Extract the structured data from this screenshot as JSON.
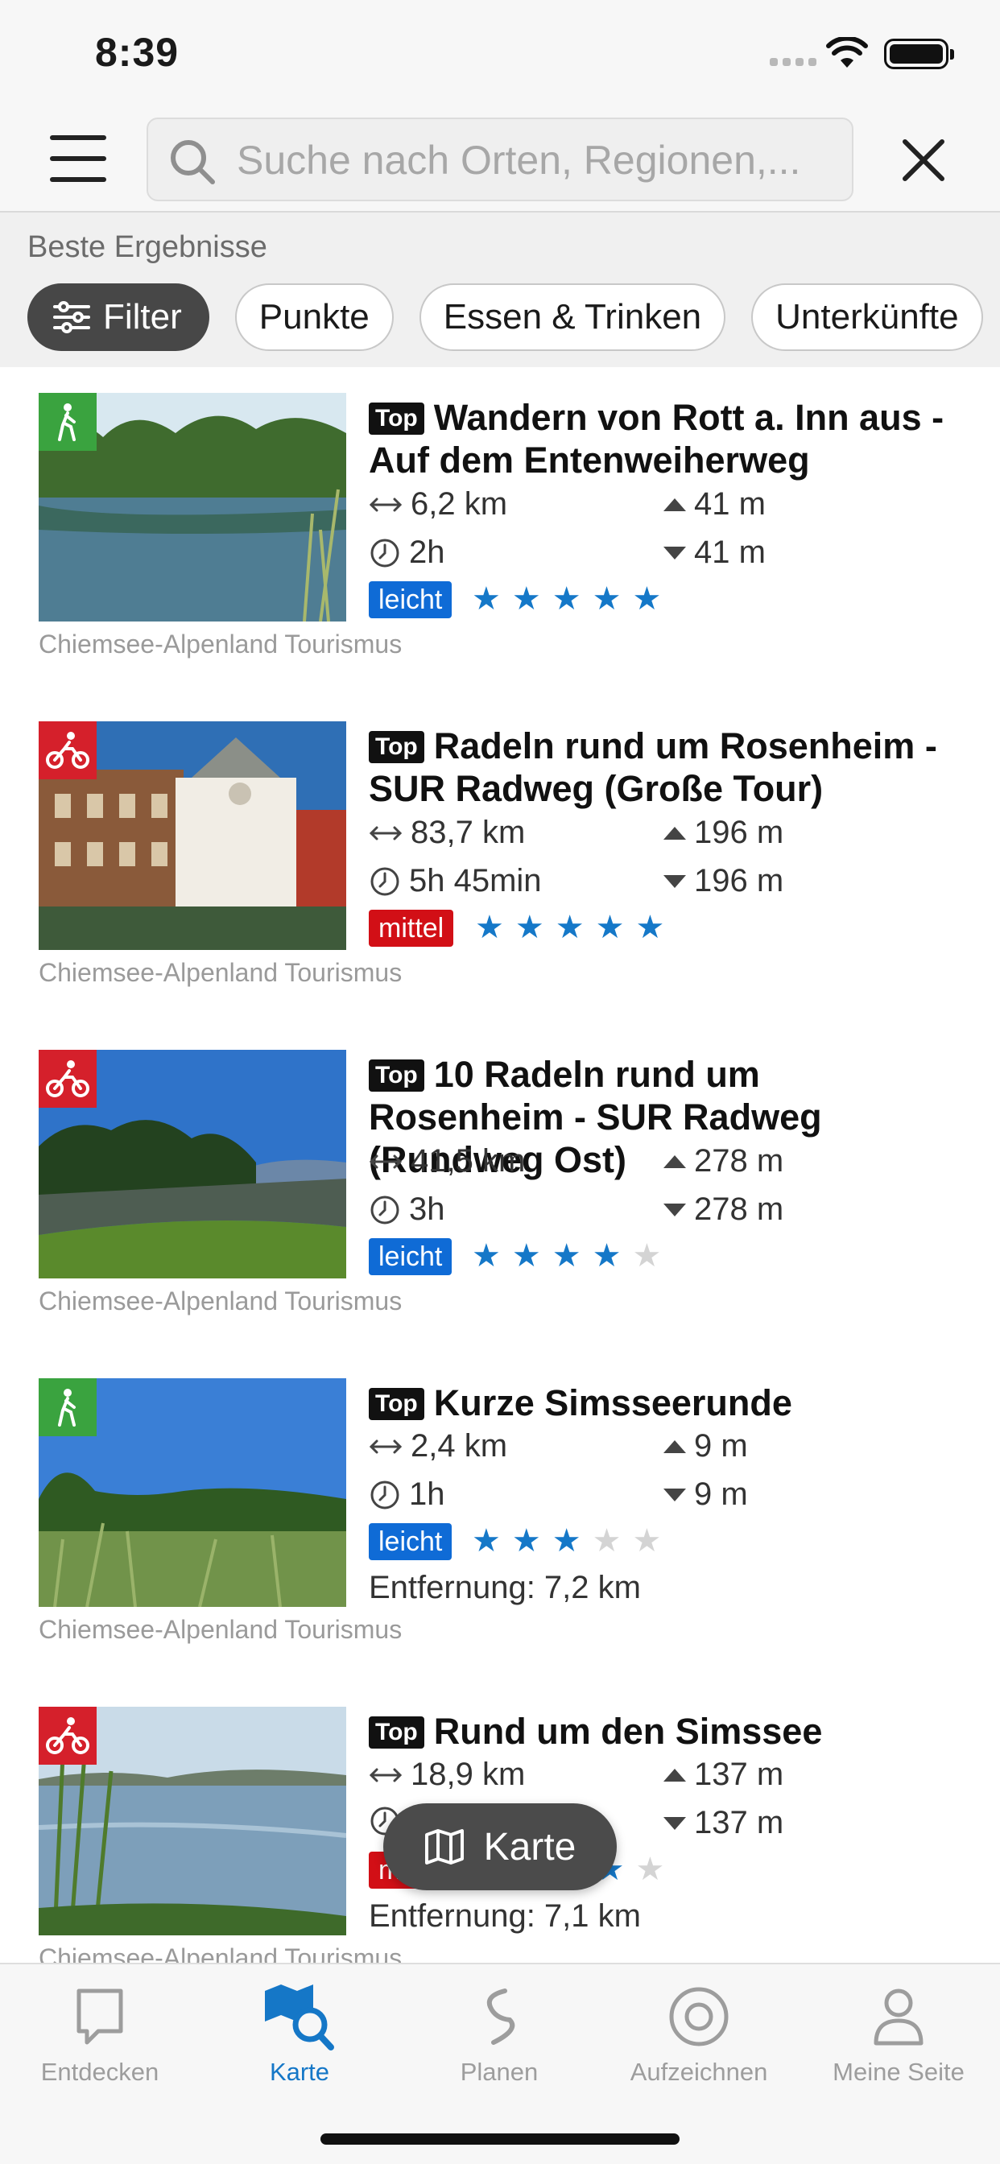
{
  "status_bar": {
    "time": "8:39"
  },
  "search": {
    "placeholder": "Suche nach Orten, Regionen,..."
  },
  "section_title": "Beste Ergebnisse",
  "filters": {
    "filter_label": "Filter",
    "chips": [
      "Punkte",
      "Essen & Trinken",
      "Unterkünfte"
    ]
  },
  "colors": {
    "accent": "#1577c7",
    "easy": "#0f6bd6",
    "medium": "#d20f16",
    "walk_badge": "#3aa33f",
    "bike_badge": "#d5202b"
  },
  "results": [
    {
      "activity_icon": "hiking-icon",
      "tag": "Top",
      "title": "Wandern von Rott a. Inn aus - Auf dem Entenweiherweg",
      "distance": "6,2 km",
      "duration": "2h",
      "ascent": "41 m",
      "descent": "41 m",
      "difficulty": "leicht",
      "rating": 5,
      "distance_from_user": "",
      "source": "Chiemsee-Alpenland Tourismus"
    },
    {
      "activity_icon": "cycling-icon",
      "tag": "Top",
      "title": "Radeln rund um Rosenheim - SUR Radweg (Große Tour)",
      "distance": "83,7 km",
      "duration": "5h 45min",
      "ascent": "196 m",
      "descent": "196 m",
      "difficulty": "mittel",
      "rating": 5,
      "distance_from_user": "",
      "source": "Chiemsee-Alpenland Tourismus"
    },
    {
      "activity_icon": "cycling-icon",
      "tag": "Top",
      "title": "10 Radeln rund um Rosenheim - SUR Radweg (Rundweg Ost)",
      "distance": "41,5 km",
      "duration": "3h",
      "ascent": "278 m",
      "descent": "278 m",
      "difficulty": "leicht",
      "rating": 4,
      "distance_from_user": "",
      "source": "Chiemsee-Alpenland Tourismus"
    },
    {
      "activity_icon": "hiking-icon",
      "tag": "Top",
      "title": "Kurze Simsseerunde",
      "distance": "2,4 km",
      "duration": "1h",
      "ascent": "9 m",
      "descent": "9 m",
      "difficulty": "leicht",
      "rating": 3,
      "distance_from_user": "Entfernung: 7,2 km",
      "source": "Chiemsee-Alpenland Tourismus"
    },
    {
      "activity_icon": "cycling-icon",
      "tag": "Top",
      "title": "Rund um den Simssee",
      "distance": "18,9 km",
      "duration": "",
      "ascent": "137 m",
      "descent": "137 m",
      "difficulty": "mittel",
      "rating": 4,
      "distance_from_user": "Entfernung: 7,1 km",
      "source": "Chiemsee-Alpenland Tourismus"
    }
  ],
  "map_button": {
    "label": "Karte"
  },
  "tabbar": {
    "active": "Karte",
    "tabs": [
      {
        "label": "Entdecken",
        "icon": "discover-icon"
      },
      {
        "label": "Karte",
        "icon": "map-search-icon"
      },
      {
        "label": "Planen",
        "icon": "route-plan-icon"
      },
      {
        "label": "Aufzeichnen",
        "icon": "record-icon"
      },
      {
        "label": "Meine Seite",
        "icon": "profile-icon"
      }
    ]
  }
}
